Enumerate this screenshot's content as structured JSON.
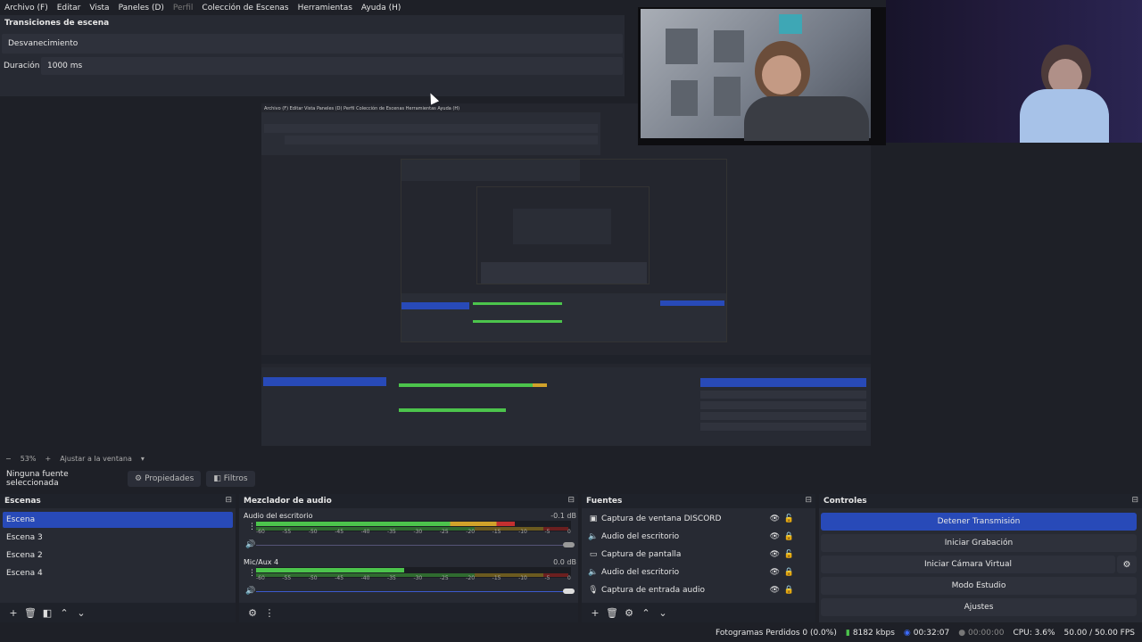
{
  "menu": [
    "Archivo (F)",
    "Editar",
    "Vista",
    "Paneles (D)",
    "Perfil",
    "Colección de Escenas",
    "Herramientas",
    "Ayuda (H)"
  ],
  "transition": {
    "title": "Transiciones de escena",
    "type": "Desvanecimiento",
    "duration_label": "Duración",
    "duration_value": "1000 ms"
  },
  "zoom": {
    "minus": "−",
    "percent": "53%",
    "plus": "+",
    "fit": "Ajustar a la ventana"
  },
  "properties_bar": {
    "no_source": "Ninguna fuente seleccionada",
    "properties": "Propiedades",
    "filters": "Filtros"
  },
  "scenes": {
    "title": "Escenas",
    "items": [
      "Escena",
      "Escena 3",
      "Escena 2",
      "Escena 4"
    ],
    "active": "Escena"
  },
  "mixer": {
    "title": "Mezclador de audio",
    "tracks": [
      {
        "name": "Audio del escritorio",
        "db": "-0.1 dB",
        "level": 0.95
      },
      {
        "name": "Mic/Aux 4",
        "db": "0.0 dB",
        "level": 0.57
      }
    ],
    "scale": [
      "-60",
      "-55",
      "-50",
      "-45",
      "-40",
      "-35",
      "-30",
      "-25",
      "-20",
      "-15",
      "-10",
      "-5",
      "0"
    ]
  },
  "sources": {
    "title": "Fuentes",
    "items": [
      {
        "label": "Captura de ventana DISCORD",
        "icon": "window-icon"
      },
      {
        "label": "Audio del escritorio",
        "icon": "speaker-icon"
      },
      {
        "label": "Captura de pantalla",
        "icon": "monitor-icon"
      },
      {
        "label": "Audio del escritorio",
        "icon": "speaker-icon"
      },
      {
        "label": "Captura de entrada audio",
        "icon": "mic-icon"
      }
    ]
  },
  "controls": {
    "title": "Controles",
    "stop_stream": "Detener Transmisión",
    "start_recording": "Iniciar Grabación",
    "start_virtual_cam": "Iniciar Cámara Virtual",
    "studio_mode": "Modo Estudio",
    "settings": "Ajustes"
  },
  "status": {
    "dropped": "Fotogramas Perdidos 0 (0.0%)",
    "bitrate": "8182 kbps",
    "stream_time": "00:32:07",
    "rec_time": "00:00:00",
    "cpu": "CPU: 3.6%",
    "fps": "50.00 / 50.00 FPS"
  },
  "colors": {
    "accent": "#284ab8",
    "meter_green": "#4cc44c",
    "meter_yellow": "#d1a22a",
    "meter_red": "#c43030"
  }
}
